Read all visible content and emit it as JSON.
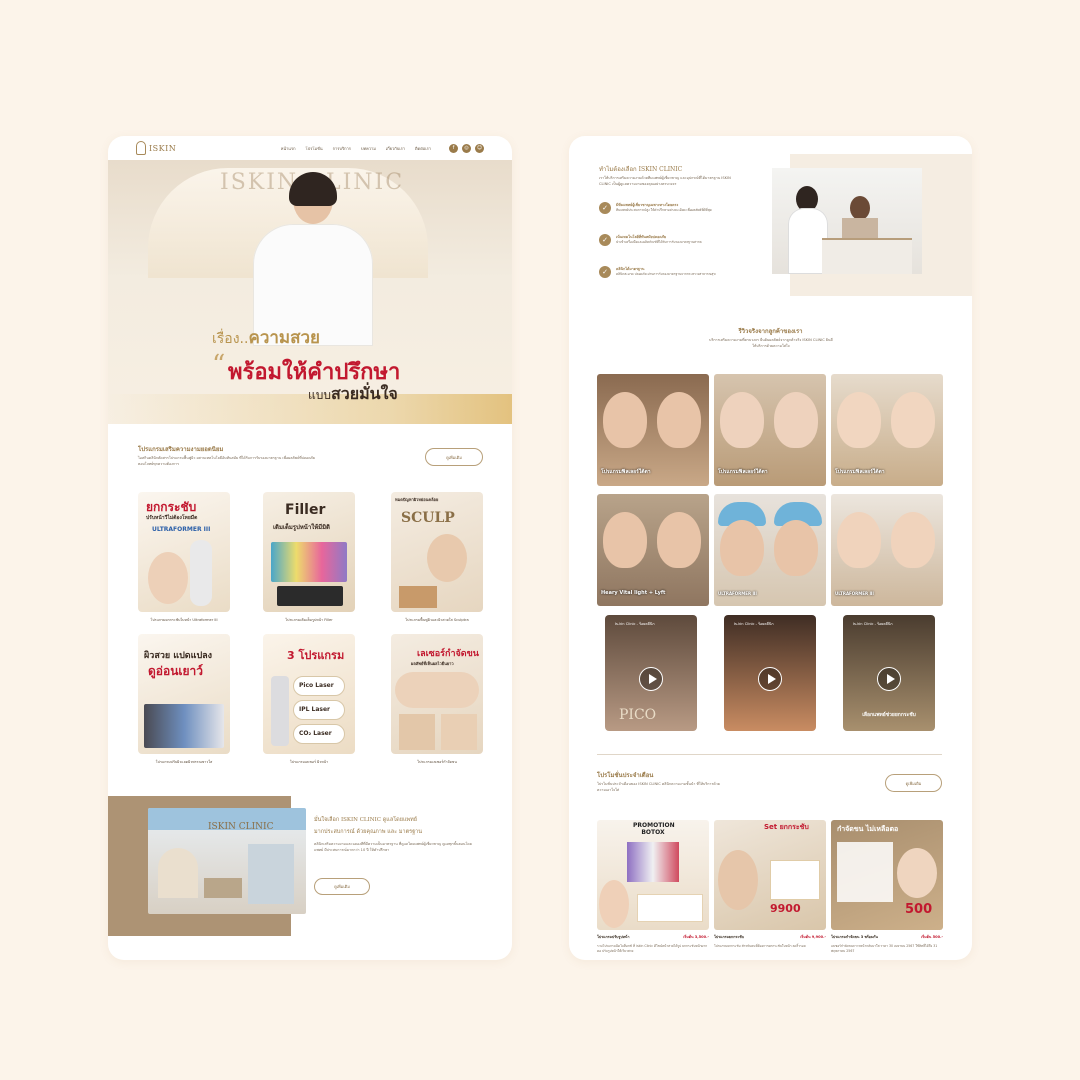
{
  "nav": {
    "logo": "ISKIN",
    "links": [
      "หน้าแรก",
      "โปรโมชั่น",
      "การบริการ",
      "บทความ",
      "เกี่ยวกับเรา",
      "ติดต่อเรา"
    ],
    "social": [
      "f",
      "◎",
      "☺"
    ]
  },
  "hero": {
    "sign": "ISKIN CLINIC",
    "line1_pre": "เรื่อง..",
    "line1_bold": "ความสวย",
    "line2": "พร้อมให้คำปรึกษา",
    "line3_pre": "แบบ",
    "line3_bold": "สวยมั่นใจ"
  },
  "programs": {
    "title": "โปรแกรมเสริมความงามยอดนิยม",
    "desc": "ไอสกินคลินิกคัดสรรโปรแกรมฟื้นฟูผิว ผสานเทคโนโลยีอันทันสมัย ที่ได้รับการรับรองมาตรฐาน เพื่อผลลัพธ์ที่ปลอดภัย ตอบโจทย์ทุกความต้องการ",
    "button": "ดูเพิ่มเติม",
    "items": [
      {
        "caption": "โปรแกรมยกกระชับใบหน้า Ultraformer III",
        "label1": "ยกกระชับ",
        "label2": "ปรับหน้าวีไม่ต้องโหยมีด",
        "label3": "ULTRAFORMER III"
      },
      {
        "caption": "โปรแกรมเติมเต็มรูปหน้า Filler",
        "label1": "Filler",
        "label2": "เติมเต็มรูปหน้าให้มีมิติ"
      },
      {
        "caption": "โปรแกรมฟื้นฟูผิวและผิวสวยใส Sculptra",
        "label1": "SCULP",
        "label2": "หมดปัญหาผิวหย่อนคล้อย"
      },
      {
        "caption": "โปรแกรมปรับผิวแลดผิวพรรณขาวใส",
        "label1": "ผิวสวย แปดแปลง",
        "label2": "ดูอ่อนเยาว์"
      },
      {
        "caption": "โปรแกรมเลเซอร์ ผิวหน้า",
        "label1": "3 โปรแกรม",
        "label2": "Pico Laser",
        "label3": "IPL Laser",
        "label4": "CO₂ Laser"
      },
      {
        "caption": "โปรแกรมเลเซอร์กำจัดขน",
        "label1": "เลเซอร์กำจัดขน",
        "label2": "ผลลัพธ์ที่เห็นผลไวยืนยาว"
      }
    ]
  },
  "clinic": {
    "title_pre": "มั่นใจเลือก",
    "title_brand": "ISKIN CLINIC",
    "title_post": "ดูแลโดยแพทย์",
    "subtitle": "มากประสบการณ์ ด้วยคุณภาพ และ มาตรฐาน",
    "desc": "คลินิกเสริมความงามและฉลองสีที่มีความเป็นมาตรฐาน ที่ดูแลโดยแพทย์ผู้เชี่ยวชาญ ดูแลทุกขั้นตอนโดยแพทย์ มีประสบการณ์มากกว่า 10 ปี ให้คำปรึกษา",
    "button": "ดูเพิ่มเติม",
    "photo_sign": "ISKIN CLINIC"
  },
  "why": {
    "title_pre": "ทำไมต้องเลือก",
    "title_brand": "ISKIN CLINIC",
    "desc": "เราให้บริการเสริมความงามด้วยทีมแพทย์ผู้เชี่ยวชาญ และอุปกรณ์ที่ได้มาตรฐาน ISKIN CLINIC เป็นผู้ดูแลความงามของคุณอย่างครบวงจร",
    "items": [
      {
        "title": "มีทีมแพทย์ผู้เชี่ยวชาญเฉพาะทางโดยตรง",
        "desc": "ทีมแพทย์ประสบการณ์สูง ให้คำปรึกษาอย่างละเอียด เพื่อผลลัพธ์ที่ดีที่สุด"
      },
      {
        "title": "เน้นเทคโนโลยีที่ทันสมัยปลอดภัย",
        "desc": "นำเข้าเครื่องมือและผลิตภัณฑ์ที่ได้รับการรับรองมาตรฐานสากล"
      },
      {
        "title": "คลินิกได้มาตรฐาน",
        "desc": "คลินิกสะอาด ปลอดภัย ผ่านการรับรองมาตรฐานจากกระทรวงสาธารณสุข"
      }
    ]
  },
  "reviews": {
    "title": "รีวิวจริงจากลูกค้าของเรา",
    "desc": "บริการเสริมความงามที่ครบวงจร ยืนยันผลลัพธ์จากลูกค้าจริง ISKIN CLINIC ยินดีให้บริการด้วยความใส่ใจ",
    "items": [
      {
        "caption": "โปรแกรมฟิลเลอร์ใต้ตา"
      },
      {
        "caption": "โปรแกรมฟิลเลอร์ใต้ตา"
      },
      {
        "caption": "โปรแกรมฟิลเลอร์ใต้ตา"
      },
      {
        "caption": "Heary Vital light + Lyft"
      },
      {
        "caption": "ULTRAFORMER III"
      },
      {
        "caption": "ULTRAFORMER III"
      }
    ],
    "videos": [
      {
        "title": "Is-kin Clinic - ร้อยคลีนิก",
        "tag": "PICO"
      },
      {
        "title": "Is-kin Clinic - ร้อยคลีนิก",
        "tag": ""
      },
      {
        "title": "Is-kin Clinic - ร้อยคลีนิก",
        "tag": "เลือกแพทย์ช่วยยกกระชับ"
      }
    ]
  },
  "promos": {
    "title": "โปรโมชั่นประจำเดือน",
    "desc": "โปรโมชั่นประจำเดือนของ ISKIN CLINIC คลินิกความงามชั้นนำ ที่ให้บริการด้วยความเอาใจใส่",
    "button": "ดูเพิ่มเติม",
    "items": [
      {
        "name": "โปรแกรมปรับรูปหน้า",
        "price": "เริ่มต้น 3,500.-",
        "headline": "PROMOTION BOTOX",
        "desc": "รวมโปรแกรมฉีดโบท็อกซ์ ที่ iskin Clinic ดีไซน์หน้าสวยได้รูป ยกกระชับหน้าผาก คอ ปรับรูปหน้าให้เรียวสวย"
      },
      {
        "name": "โปรแกรมยกกระชับ",
        "price": "เริ่มต้น 9,900.-",
        "headline": "Set ยกกระชับ",
        "big": "9900",
        "desc": "โปรแกรมยกกระชับ สำหรับคนที่ต้องการยกกระชับใบหน้า ลดริ้วรอย"
      },
      {
        "name": "โปรแกรมกำจัดขน 3 พร้อมกัน",
        "price": "เริ่มต้น 500.-",
        "headline": "กำจัดขน ไม่เหลือตอ",
        "big": "500",
        "desc": "เลเซอร์กำจัดขนถาวรหน้ากลับมาใส ราคา 30 เมษายน 2567 ใช้สิทธิ์ได้ถึง 31 พฤษภาคม 2567"
      }
    ]
  },
  "colors": {
    "gold": "#9a7b4a",
    "red": "#c2182f",
    "cream": "#fcf4ea"
  }
}
